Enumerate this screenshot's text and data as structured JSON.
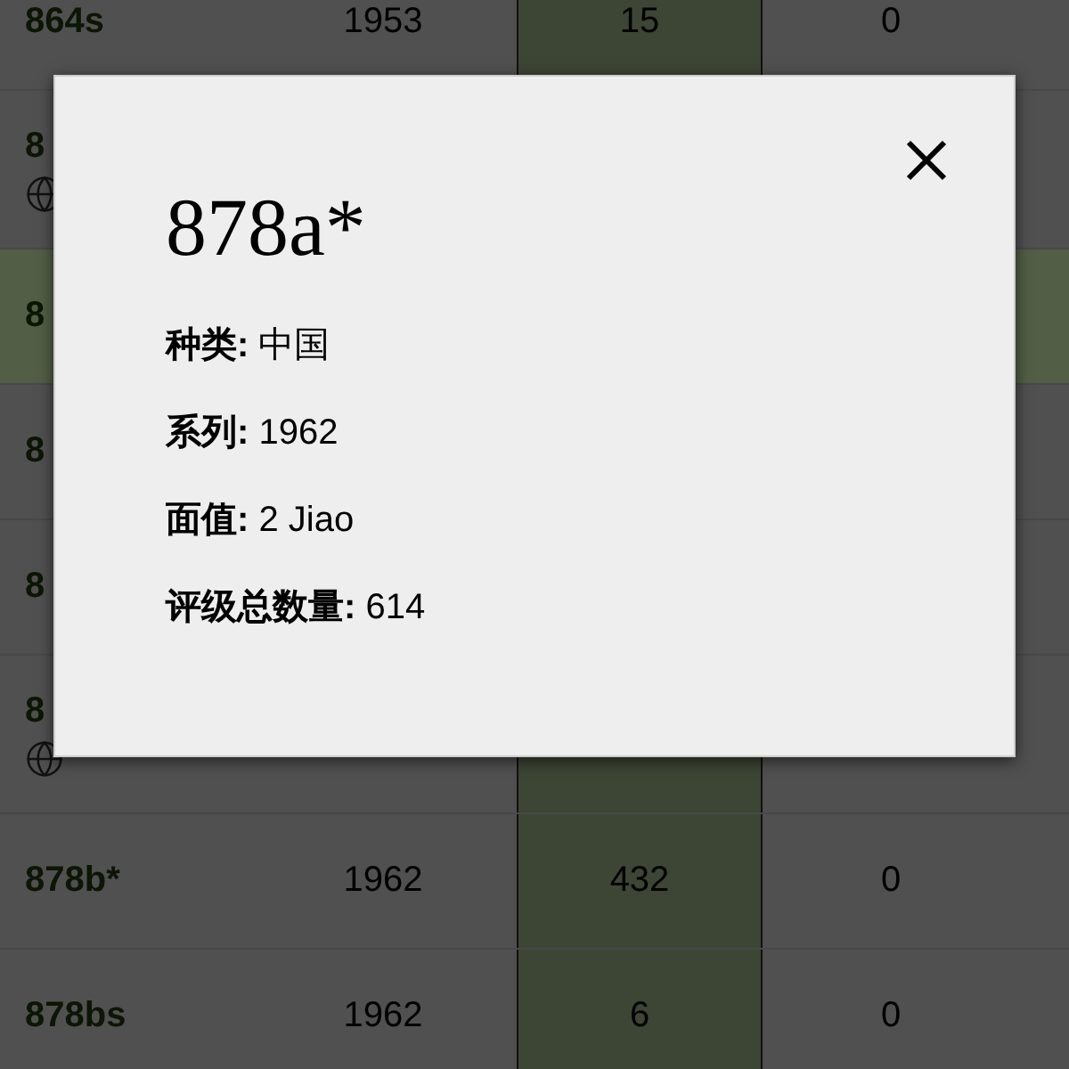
{
  "table": {
    "rows": [
      {
        "code": "864s",
        "year": "1953",
        "count": "15",
        "column_4": "0",
        "selected": false,
        "globe": false
      },
      {
        "code": "8",
        "selected": false,
        "globe": true
      },
      {
        "code": "8",
        "selected": true,
        "globe": false
      },
      {
        "code": "8",
        "selected": false,
        "globe": false
      },
      {
        "code": "8",
        "selected": false,
        "globe": false
      },
      {
        "code": "8",
        "selected": false,
        "globe": true
      },
      {
        "code": "878b*",
        "year": "1962",
        "count": "432",
        "column_4": "0",
        "selected": false,
        "globe": false
      },
      {
        "code": "878bs",
        "year": "1962",
        "count": "6",
        "column_4": "0",
        "selected": false,
        "globe": false
      }
    ]
  },
  "dialog": {
    "title": "878a*",
    "fields": [
      {
        "label": "种类:",
        "value": "中国"
      },
      {
        "label": "系列:",
        "value": "1962"
      },
      {
        "label": "面值:",
        "value": "2 Jiao"
      },
      {
        "label": "评级总数量:",
        "value": "614"
      }
    ]
  }
}
